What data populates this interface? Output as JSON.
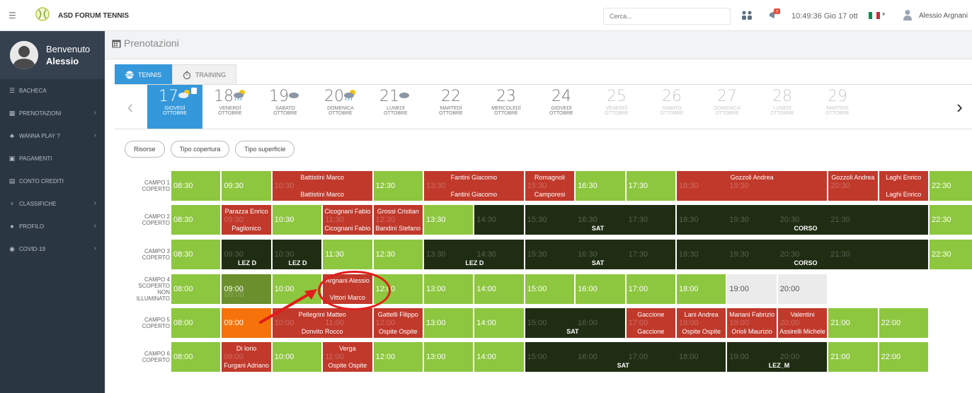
{
  "topbar": {
    "menu_icon": "☰",
    "app_name": "ASD FORUM TENNIS",
    "search_placeholder": "Cerca...",
    "clock": "10:49:36 Gio 17 ott",
    "caret": "▾",
    "username": "Alessio Argnani"
  },
  "sidebar": {
    "welcome": "Benvenuto",
    "name": "Alessio",
    "items": [
      {
        "label": "BACHECA",
        "icon": "☰",
        "chevron": ""
      },
      {
        "label": "PRENOTAZIONI",
        "icon": "▦",
        "chevron": "›"
      },
      {
        "label": "WANNA PLAY ?",
        "icon": "♣",
        "chevron": "›"
      },
      {
        "label": "PAGAMENTI",
        "icon": "▣",
        "chevron": ""
      },
      {
        "label": "CONTO CREDITI",
        "icon": "▤",
        "chevron": ""
      },
      {
        "label": "CLASSIFICHE",
        "icon": "♆",
        "chevron": "›"
      },
      {
        "label": "PROFILO",
        "icon": "●",
        "chevron": "›"
      },
      {
        "label": "COVID-19",
        "icon": "◉",
        "chevron": "›"
      }
    ]
  },
  "page": {
    "title": "Prenotazioni",
    "tabs": [
      {
        "label": "TENNIS"
      },
      {
        "label": "TRAINING"
      }
    ],
    "prev": "‹",
    "next": "›",
    "filters": [
      "Risorse",
      "Tipo copertura",
      "Tipo superficie"
    ]
  },
  "days": [
    {
      "num": "17",
      "day": "GIOVEDÌ",
      "month": "OTTOBRE"
    },
    {
      "num": "18",
      "day": "VENERDÌ",
      "month": "OTTOBRE"
    },
    {
      "num": "19",
      "day": "SABATO",
      "month": "OTTOBRE"
    },
    {
      "num": "20",
      "day": "DOMENICA",
      "month": "OTTOBRE"
    },
    {
      "num": "21",
      "day": "LUNEDÌ",
      "month": "OTTOBRE"
    },
    {
      "num": "22",
      "day": "MARTEDÌ",
      "month": "OTTOBRE"
    },
    {
      "num": "23",
      "day": "MERCOLEDÌ",
      "month": "OTTOBRE"
    },
    {
      "num": "24",
      "day": "GIOVEDÌ",
      "month": "OTTOBRE"
    },
    {
      "num": "25",
      "day": "VENERDÌ",
      "month": "OTTOBRE"
    },
    {
      "num": "26",
      "day": "SABATO",
      "month": "OTTOBRE"
    },
    {
      "num": "27",
      "day": "DOMENICA",
      "month": "OTTOBRE"
    },
    {
      "num": "28",
      "day": "LUNEDÌ",
      "month": "OTTOBRE"
    },
    {
      "num": "29",
      "day": "MARTEDÌ",
      "month": "OTTOBRE"
    }
  ],
  "courts": [
    {
      "label": "CAMPO 1\nCOPERTO"
    },
    {
      "label": "CAMPO 2\nCOPERTO"
    },
    {
      "label": "CAMPO 3\nCOPERTO"
    },
    {
      "label": "CAMPO 4\nSCOPERTO\nNON\nILLUMINATO"
    },
    {
      "label": "CAMPO 5\nCOPERTO"
    },
    {
      "label": "CAMPO 6\nCOPERTO"
    }
  ],
  "slots": {
    "r0": [
      {
        "t": "08:30"
      },
      {
        "t": "09:30"
      },
      {
        "n1": "Battistini Marco",
        "n2": "Battistini Marco",
        "g": "10:30"
      },
      {
        "t": "12:30"
      },
      {
        "n1": "Fantini Giacomo",
        "n2": "Fantini Giacomo",
        "g": "13:30"
      },
      {
        "n1": "Romagnoli",
        "n2": "Camporesi",
        "g": "15:30"
      },
      {
        "t": "16:30"
      },
      {
        "t": "17:30"
      },
      {
        "n1": "Gozzoli Andrea",
        "g1": "18:30",
        "g2": "19:30"
      },
      {
        "n1": "Gozzoli Andrea",
        "g": "20:30"
      },
      {
        "n1": "Laghi Enrico",
        "n2": "Laghi Enrico"
      },
      {
        "t": "22:30"
      }
    ],
    "r1": [
      {
        "t": "08:30"
      },
      {
        "n1": "Parazza Enrico",
        "n2": "Paglionico",
        "g": "09:30"
      },
      {
        "t": "10:30"
      },
      {
        "n1": "Cicognani Fabio",
        "n2": "Cicognani Fabio",
        "g": "11:30"
      },
      {
        "n1": "Grossi Cristian",
        "n2": "Bandini Stefano",
        "g": "12:30"
      },
      {
        "t": "13:30"
      },
      {
        "g": "14:30"
      },
      {
        "g1": "15:30",
        "g2": "16:30",
        "g3": "17:30",
        "lab": "SAT"
      },
      {
        "g1": "18:30",
        "g2": "19:30",
        "g3": "20:30",
        "g4": "21:30",
        "lab": "CORSO"
      },
      {
        "t": "22:30"
      }
    ],
    "r2": [
      {
        "t": "08:30"
      },
      {
        "g": "09:30",
        "lab": "LEZ D"
      },
      {
        "g": "10:30",
        "lab": "LEZ D"
      },
      {
        "t": "11:30"
      },
      {
        "t": "12:30"
      },
      {
        "g1": "13:30",
        "g2": "14:30",
        "lab": "LEZ D"
      },
      {
        "g1": "15:30",
        "g2": "16:30",
        "g3": "17:30",
        "lab": "SAT"
      },
      {
        "g1": "18:30",
        "g2": "19:30",
        "g3": "20:30",
        "g4": "21:30",
        "lab": "CORSO"
      },
      {
        "t": "22:30"
      }
    ],
    "r3": [
      {
        "t": "08:00"
      },
      {
        "t": "09:00",
        "g": "09:00"
      },
      {
        "t": "10:00"
      },
      {
        "n1": "Argnani Alessio",
        "n2": "Vittori Marco"
      },
      {
        "t": "12:00"
      },
      {
        "t": "13:00"
      },
      {
        "t": "14:00"
      },
      {
        "t": "15:00"
      },
      {
        "t": "16:00"
      },
      {
        "t": "17:00"
      },
      {
        "t": "18:00"
      },
      {
        "t": "19:00"
      },
      {
        "t": "20:00"
      }
    ],
    "r4": [
      {
        "t": "08:00"
      },
      {
        "t": "09:00"
      },
      {
        "n1": "Pellegrini Matteo",
        "n2": "Donvito Rocco",
        "g1": "10:00",
        "g2": "11:00"
      },
      {
        "n1": "Gattelli Filippo",
        "n2": "Ospite Ospite",
        "g": "12:00"
      },
      {
        "t": "13:00"
      },
      {
        "t": "14:00"
      },
      {
        "g1": "15:00",
        "g2": "16:00",
        "lab": "SAT"
      },
      {
        "n1": "Gaccione",
        "n2": "Gaccione",
        "g": "17:00"
      },
      {
        "n1": "Lani Andrea",
        "n2": "Ospite Ospite",
        "g": "18:00"
      },
      {
        "n1": "Mariani Fabrizio",
        "n2": "Orioli Maurizio",
        "g": "19:00"
      },
      {
        "n1": "Valentini",
        "n2": "Assirelli Michele",
        "g": "20:00"
      },
      {
        "t": "21:00"
      },
      {
        "t": "22:00"
      }
    ],
    "r5": [
      {
        "t": "08:00"
      },
      {
        "n1": "Di Iorio",
        "n2": "Furgani Adriano",
        "g": "09:00"
      },
      {
        "t": "10:00"
      },
      {
        "n1": "Verga",
        "n2": "Ospite Ospite",
        "g": "11:00"
      },
      {
        "t": "12:00"
      },
      {
        "t": "13:00"
      },
      {
        "t": "14:00"
      },
      {
        "g1": "15:00",
        "g2": "16:00",
        "g3": "17:00",
        "g4": "18:00",
        "lab": "SAT"
      },
      {
        "g1": "19:00",
        "g2": "20:00",
        "lab": "LEZ_M"
      },
      {
        "t": "21:00"
      },
      {
        "t": "22:00"
      }
    ]
  },
  "colors": {
    "free": "#8dc63f",
    "booked": "#c0392b",
    "dark": "#1f2d13",
    "accent": "#3498db",
    "sidebar": "#2b3643",
    "annotation": "#e31c1c"
  }
}
